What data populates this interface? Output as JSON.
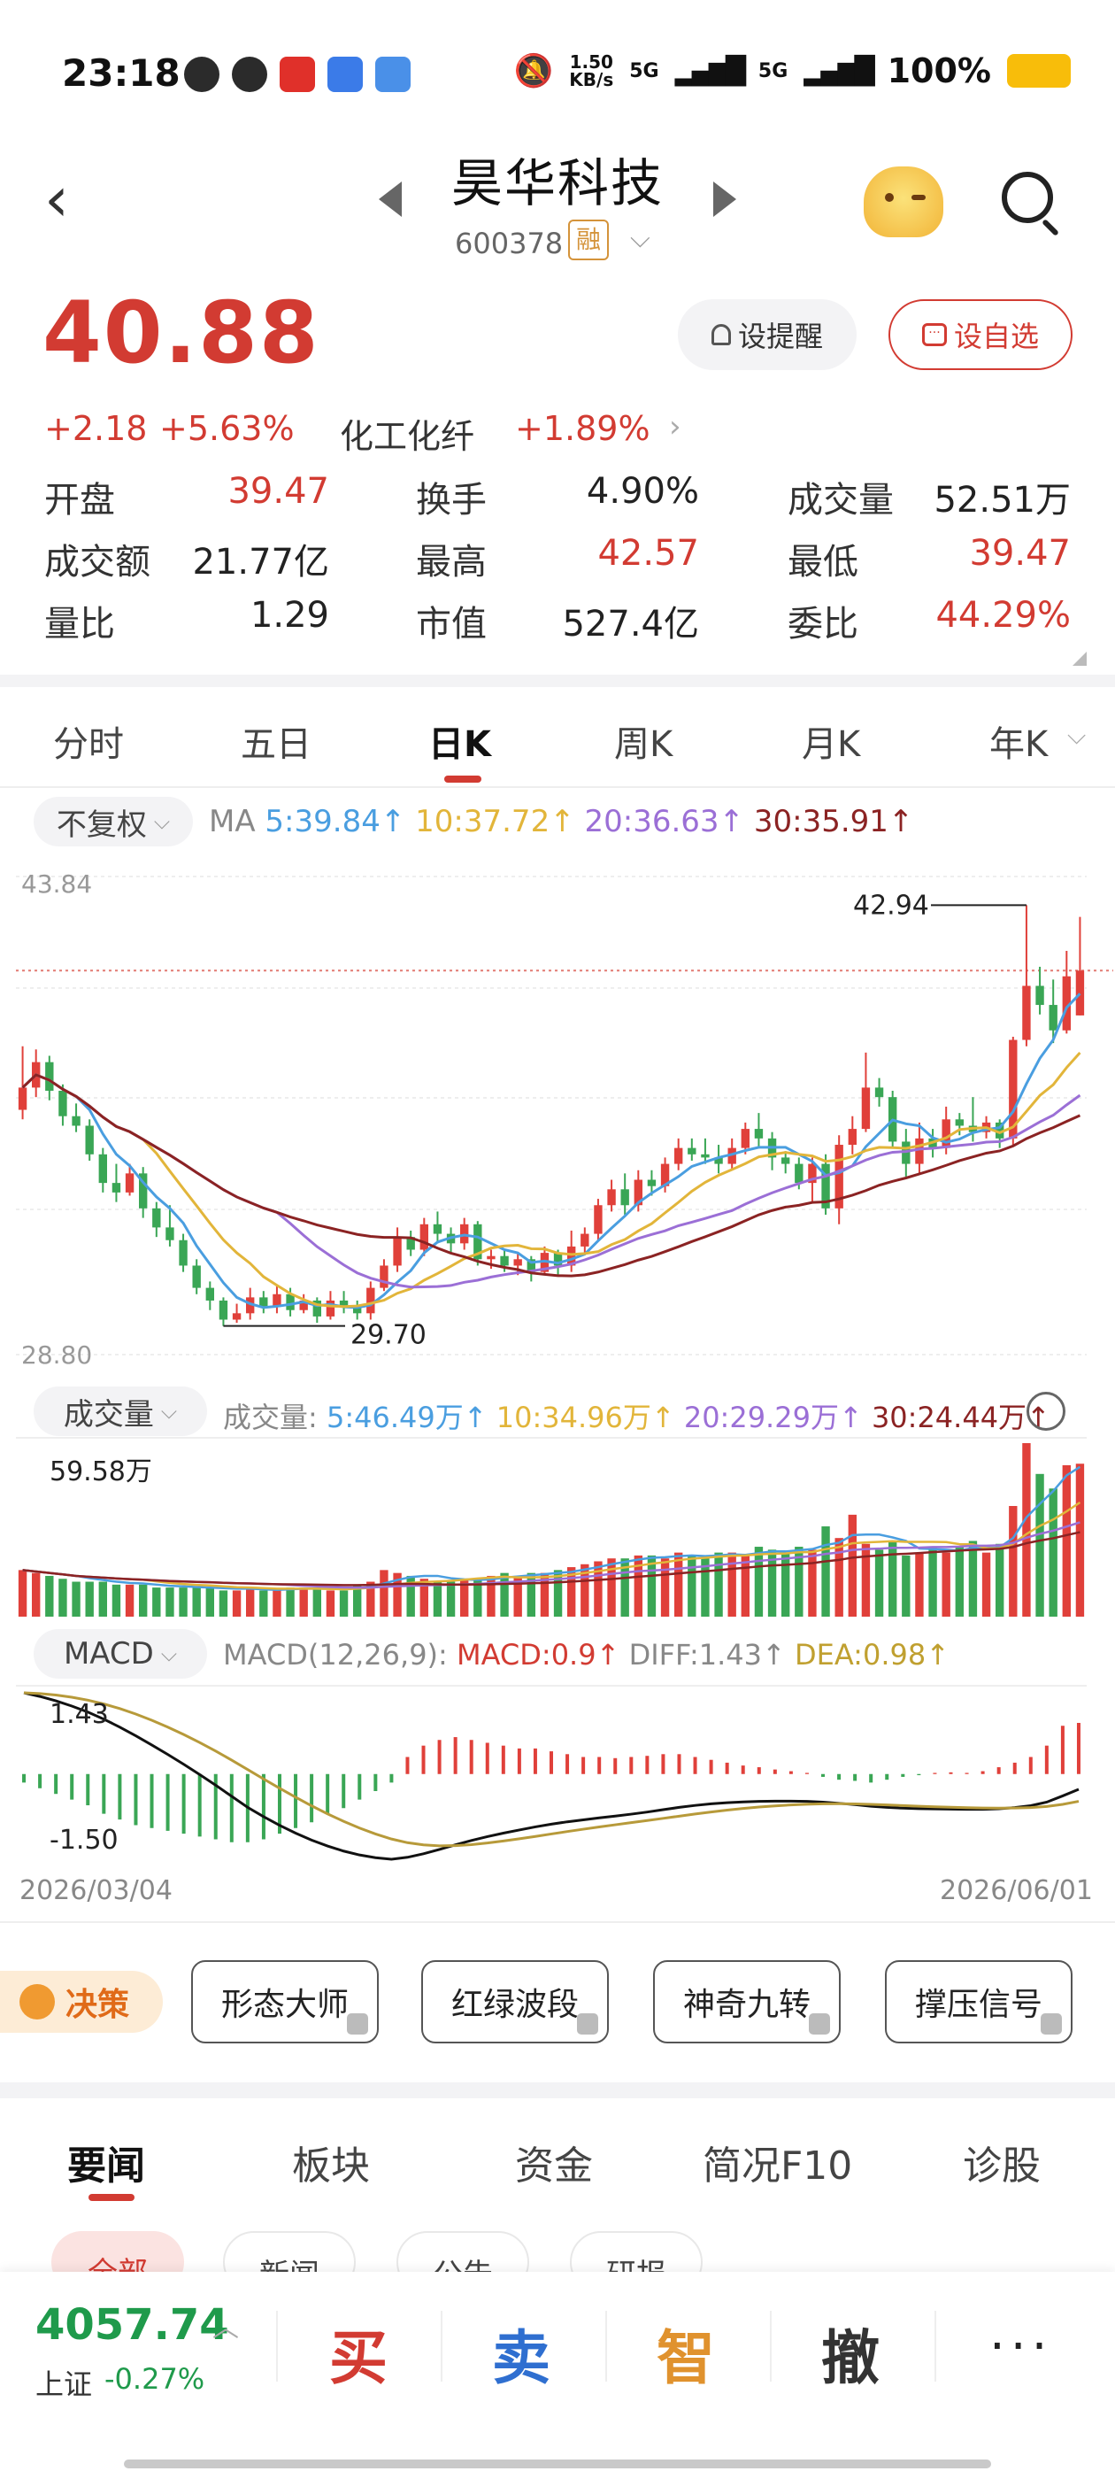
{
  "status": {
    "time": "23:18",
    "net_speed_value": "1.50",
    "net_speed_unit": "KB/s",
    "sim1": "5G",
    "sim2": "5G",
    "battery": "100%"
  },
  "header": {
    "name": "昊华科技",
    "code": "600378",
    "badge": "融"
  },
  "quote": {
    "price": "40.88",
    "change": "+2.18",
    "change_pct": "+5.63%",
    "sector": "化工化纤",
    "sector_pct": "+1.89%",
    "alert_label": "设提醒",
    "watch_label": "设自选",
    "stats": [
      {
        "label": "开盘",
        "value": "39.47",
        "color": "#d23b32"
      },
      {
        "label": "换手",
        "value": "4.90%",
        "color": "#222222"
      },
      {
        "label": "成交量",
        "value": "52.51万",
        "color": "#222222"
      },
      {
        "label": "成交额",
        "value": "21.77亿",
        "color": "#222222"
      },
      {
        "label": "最高",
        "value": "42.57",
        "color": "#d23b32"
      },
      {
        "label": "最低",
        "value": "39.47",
        "color": "#d23b32"
      },
      {
        "label": "量比",
        "value": "1.29",
        "color": "#222222"
      },
      {
        "label": "市值",
        "value": "527.4亿",
        "color": "#222222"
      },
      {
        "label": "委比",
        "value": "44.29%",
        "color": "#d23b32"
      }
    ]
  },
  "tabs": [
    "分时",
    "五日",
    "日K",
    "周K",
    "月K",
    "年K"
  ],
  "chart_toolbar": {
    "adjust": "不复权",
    "ma_prefix": "MA",
    "ma5": "5:39.84↑",
    "ma10": "10:37.72↑",
    "ma20": "20:36.63↑",
    "ma30": "30:35.91↑",
    "vol_pill": "成交量",
    "vol_prefix": "成交量:",
    "vol5": "5:46.49万↑",
    "vol10": "10:34.96万↑",
    "vol20": "20:29.29万↑",
    "vol30": "30:24.44万↑",
    "macd_pill": "MACD",
    "macd_prefix": "MACD(12,26,9):",
    "macd_val": "MACD:0.9↑",
    "diff_val": "DIFF:1.43↑",
    "dea_val": "DEA:0.98↑"
  },
  "chart_data": {
    "type": "candlestick",
    "price_axis": {
      "max_label": "43.84",
      "min_label": "28.80",
      "max": 43.84,
      "min": 28.8
    },
    "high_annotation": "42.94",
    "low_annotation": "29.70",
    "volume_max_label": "59.58万",
    "macd_axis": {
      "max_label": "1.43",
      "min_label": "-1.50",
      "max": 1.43,
      "min": -1.5
    },
    "x_start": "2026/03/04",
    "x_end": "2026/06/01",
    "candles": [
      [
        36.5,
        37.2,
        38.5,
        36.2
      ],
      [
        37.2,
        38.0,
        38.4,
        36.9
      ],
      [
        38.0,
        37.1,
        38.2,
        36.8
      ],
      [
        37.1,
        36.3,
        37.3,
        36.0
      ],
      [
        36.3,
        36.0,
        36.7,
        35.8
      ],
      [
        36.0,
        35.1,
        36.2,
        34.9
      ],
      [
        35.1,
        34.2,
        35.3,
        33.9
      ],
      [
        34.2,
        33.9,
        34.8,
        33.6
      ],
      [
        33.9,
        34.5,
        34.8,
        33.8
      ],
      [
        34.5,
        33.4,
        34.7,
        33.1
      ],
      [
        33.4,
        32.8,
        33.6,
        32.5
      ],
      [
        32.8,
        32.4,
        33.5,
        32.2
      ],
      [
        32.4,
        31.6,
        32.6,
        31.4
      ],
      [
        31.6,
        30.9,
        31.8,
        30.7
      ],
      [
        30.9,
        30.5,
        31.1,
        30.2
      ],
      [
        30.5,
        29.9,
        30.6,
        29.7
      ],
      [
        29.9,
        30.1,
        30.4,
        29.8
      ],
      [
        30.1,
        30.6,
        30.9,
        29.9
      ],
      [
        30.6,
        30.3,
        30.8,
        30.1
      ],
      [
        30.3,
        30.7,
        31.0,
        30.1
      ],
      [
        30.7,
        30.2,
        30.9,
        30.0
      ],
      [
        30.2,
        30.5,
        30.7,
        30.1
      ],
      [
        30.5,
        30.0,
        30.6,
        29.8
      ],
      [
        30.0,
        30.5,
        30.8,
        29.9
      ],
      [
        30.5,
        30.3,
        30.8,
        30.1
      ],
      [
        30.3,
        30.1,
        30.5,
        29.9
      ],
      [
        30.1,
        30.9,
        31.1,
        29.9
      ],
      [
        30.9,
        31.6,
        31.8,
        30.8
      ],
      [
        31.6,
        32.5,
        32.8,
        31.4
      ],
      [
        32.5,
        32.1,
        32.7,
        31.9
      ],
      [
        32.1,
        32.9,
        33.1,
        31.9
      ],
      [
        32.9,
        32.6,
        33.3,
        32.3
      ],
      [
        32.6,
        32.3,
        32.8,
        32.0
      ],
      [
        32.3,
        32.9,
        33.1,
        32.1
      ],
      [
        32.9,
        31.8,
        33.0,
        31.6
      ],
      [
        31.8,
        31.9,
        32.1,
        31.5
      ],
      [
        31.9,
        31.6,
        32.1,
        31.4
      ],
      [
        31.6,
        31.8,
        32.0,
        31.3
      ],
      [
        31.8,
        31.4,
        31.9,
        31.1
      ],
      [
        31.4,
        32.0,
        32.2,
        31.3
      ],
      [
        32.0,
        31.6,
        32.1,
        31.3
      ],
      [
        31.6,
        32.2,
        32.7,
        31.4
      ],
      [
        32.2,
        32.6,
        32.8,
        32.0
      ],
      [
        32.6,
        33.5,
        33.7,
        32.4
      ],
      [
        33.5,
        34.0,
        34.3,
        33.3
      ],
      [
        34.0,
        33.5,
        34.5,
        33.2
      ],
      [
        33.5,
        34.3,
        34.6,
        33.3
      ],
      [
        34.3,
        34.1,
        34.6,
        33.8
      ],
      [
        34.1,
        34.8,
        35.0,
        33.9
      ],
      [
        34.8,
        35.3,
        35.6,
        34.6
      ],
      [
        35.3,
        35.1,
        35.6,
        34.9
      ],
      [
        35.1,
        35.0,
        35.6,
        34.8
      ],
      [
        35.0,
        34.8,
        35.4,
        34.5
      ],
      [
        34.8,
        35.3,
        35.6,
        34.6
      ],
      [
        35.3,
        35.9,
        36.1,
        35.1
      ],
      [
        35.9,
        35.6,
        36.4,
        35.3
      ],
      [
        35.6,
        35.0,
        35.8,
        34.6
      ],
      [
        35.0,
        34.8,
        35.2,
        34.5
      ],
      [
        34.8,
        34.2,
        35.0,
        34.0
      ],
      [
        34.2,
        34.8,
        35.0,
        33.6
      ],
      [
        34.8,
        33.4,
        35.1,
        33.2
      ],
      [
        33.4,
        35.4,
        35.7,
        32.9
      ],
      [
        35.4,
        35.9,
        36.3,
        35.1
      ],
      [
        35.9,
        37.2,
        38.3,
        35.8
      ],
      [
        37.2,
        36.9,
        37.5,
        36.6
      ],
      [
        36.9,
        35.5,
        37.1,
        35.3
      ],
      [
        35.5,
        34.8,
        35.9,
        34.4
      ],
      [
        34.8,
        35.6,
        36.1,
        34.5
      ],
      [
        35.6,
        35.3,
        35.9,
        35.0
      ],
      [
        35.3,
        36.2,
        36.6,
        35.1
      ],
      [
        36.2,
        36.0,
        36.4,
        35.7
      ],
      [
        36.0,
        35.8,
        36.9,
        35.5
      ],
      [
        35.8,
        36.1,
        36.3,
        35.6
      ],
      [
        36.1,
        35.6,
        36.2,
        35.3
      ],
      [
        35.6,
        38.7,
        38.8,
        35.4
      ],
      [
        38.7,
        40.4,
        42.94,
        38.5
      ],
      [
        40.4,
        39.8,
        41.0,
        39.5
      ],
      [
        39.8,
        39.0,
        40.6,
        38.6
      ],
      [
        39.0,
        40.7,
        41.5,
        38.9
      ],
      [
        39.47,
        40.88,
        42.57,
        39.47
      ]
    ],
    "volumes": [
      16,
      15,
      14,
      13,
      12,
      12,
      12,
      11,
      11,
      11,
      10,
      10,
      10,
      10,
      10,
      9,
      9,
      10,
      9,
      9,
      10,
      10,
      10,
      9,
      9,
      11,
      12,
      16,
      15,
      14,
      13,
      12,
      12,
      13,
      13,
      14,
      15,
      14,
      15,
      15,
      16,
      17,
      18,
      19,
      20,
      20,
      21,
      21,
      20,
      22,
      21,
      20,
      22,
      22,
      21,
      24,
      23,
      22,
      24,
      23,
      31,
      27,
      35,
      25,
      23,
      26,
      21,
      22,
      24,
      22,
      24,
      26,
      22,
      25,
      38,
      59.58,
      49,
      44,
      52,
      52.51
    ],
    "macd_hist": [
      -0.15,
      -0.25,
      -0.35,
      -0.45,
      -0.55,
      -0.7,
      -0.8,
      -0.9,
      -0.95,
      -1.0,
      -1.05,
      -1.1,
      -1.15,
      -1.2,
      -1.2,
      -1.15,
      -1.05,
      -0.95,
      -0.85,
      -0.7,
      -0.6,
      -0.45,
      -0.3,
      -0.15,
      0.3,
      0.5,
      0.6,
      0.65,
      0.6,
      0.55,
      0.5,
      0.45,
      0.45,
      0.4,
      0.35,
      0.3,
      0.3,
      0.28,
      0.3,
      0.32,
      0.35,
      0.35,
      0.3,
      0.25,
      0.2,
      0.15,
      0.12,
      0.08,
      0.05,
      0.02,
      -0.05,
      -0.1,
      -0.12,
      -0.15,
      -0.1,
      -0.05,
      -0.02,
      0.02,
      0.03,
      0.02,
      0.05,
      0.12,
      0.2,
      0.3,
      0.5,
      0.85,
      0.9
    ]
  },
  "strategy": {
    "badge": "决策",
    "chips": [
      "形态大师",
      "红绿波段",
      "神奇九转",
      "撑压信号"
    ]
  },
  "news_tabs": [
    "要闻",
    "板块",
    "资金",
    "简况F10",
    "诊股"
  ],
  "news_subtabs": [
    "全部",
    "新闻",
    "公告",
    "研报"
  ],
  "bottom": {
    "index_value": "4057.74",
    "index_name": "上证",
    "index_pct": "-0.27%",
    "buy": "买",
    "sell": "卖",
    "smart": "智",
    "cancel": "撤",
    "more": "···"
  }
}
